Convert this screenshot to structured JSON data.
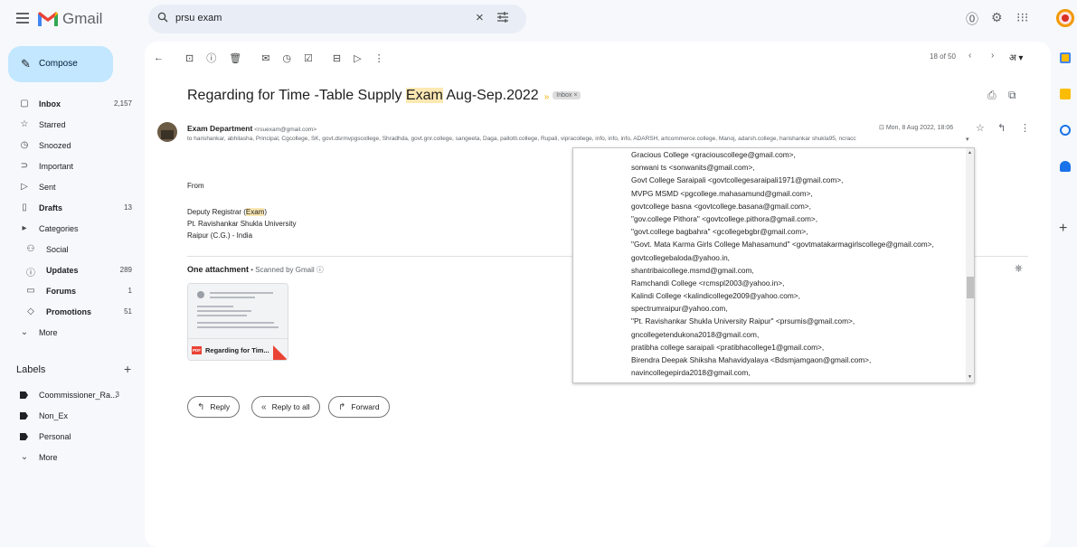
{
  "app": {
    "name": "Gmail"
  },
  "search": {
    "query": "prsu exam"
  },
  "compose": {
    "label": "Compose"
  },
  "nav": [
    {
      "label": "Inbox",
      "count": "2,157",
      "icon": "inbox-icon",
      "glyph": "▢",
      "bold": true
    },
    {
      "label": "Starred",
      "count": "",
      "icon": "star-icon",
      "glyph": "☆",
      "bold": false
    },
    {
      "label": "Snoozed",
      "count": "",
      "icon": "clock-icon",
      "glyph": "◷",
      "bold": false
    },
    {
      "label": "Important",
      "count": "",
      "icon": "important-icon",
      "glyph": "⊃",
      "bold": false
    },
    {
      "label": "Sent",
      "count": "",
      "icon": "send-icon",
      "glyph": "▷",
      "bold": false
    },
    {
      "label": "Drafts",
      "count": "13",
      "icon": "draft-icon",
      "glyph": "▯",
      "bold": true
    },
    {
      "label": "Categories",
      "count": "",
      "icon": "label-icon",
      "glyph": "▸",
      "bold": false
    },
    {
      "label": "Social",
      "count": "",
      "icon": "people-icon",
      "glyph": "⚇",
      "bold": false,
      "sub": true
    },
    {
      "label": "Updates",
      "count": "289",
      "icon": "info-icon",
      "glyph": "ⓘ",
      "bold": true,
      "sub": true
    },
    {
      "label": "Forums",
      "count": "1",
      "icon": "forum-icon",
      "glyph": "▭",
      "bold": true,
      "sub": true
    },
    {
      "label": "Promotions",
      "count": "51",
      "icon": "tag-icon",
      "glyph": "◇",
      "bold": true,
      "sub": true
    },
    {
      "label": "More",
      "count": "",
      "icon": "chevron-down-icon",
      "glyph": "⌄",
      "bold": false
    }
  ],
  "labels": {
    "header": "Labels",
    "items": [
      {
        "label": "Coommissioner_Ra...",
        "count": "3"
      },
      {
        "label": "Non_Ex",
        "count": ""
      },
      {
        "label": "Personal",
        "count": ""
      },
      {
        "label": "More",
        "count": ""
      }
    ]
  },
  "toolbar": {
    "pager": "18 of 50",
    "lang": "अ"
  },
  "email": {
    "subject_pre": "Regarding for Time -Table Supply ",
    "subject_hl": "Exam",
    "subject_post": " Aug-Sep.2022",
    "inbox_chip": "Inbox ×",
    "sender_name": "Exam Department",
    "sender_email": "<rsuexam@gmail.com>",
    "date": "Mon, 8 Aug 2022, 18:06",
    "recipients": "to harishankar, abhilasha, Principal, Cgcollege, SK, govt.dsrmvpgscollege, Shradhda, govt.gnr.college, sangeeta, Daga, pallotti.college, Rupali, vipracollege, info, info, info, ADARSH, artcommerce.college, Manoj, adarsh.college, harishankar shukla95, ncracc",
    "from_label": "From",
    "sig_pre": "Deputy Registrar (",
    "sig_hl": "Exam",
    "sig_post": ")",
    "sig_line2": "Pt. Ravishankar Shukla University",
    "sig_line3": "Raipur (C.G.) - India"
  },
  "attachment": {
    "header": "One attachment",
    "scan": " • Scanned by Gmail ⓘ",
    "name": "Regarding for Tim...",
    "badge": "PDF"
  },
  "buttons": {
    "reply": "Reply",
    "reply_all": "Reply to all",
    "forward": "Forward"
  },
  "popup": {
    "items": [
      "Gracious College <graciouscollege@gmail.com>,",
      "sonwani ts <sonwanits@gmail.com>,",
      "Govt College Saraipali <govtcollegesaraipali1971@gmail.com>,",
      "MVPG MSMD <pgcollege.mahasamund@gmail.com>,",
      "govtcollege basna <govtcollege.basana@gmail.com>,",
      "\"gov.college Pithora\" <govtcollege.pithora@gmail.com>,",
      "\"govt.college bagbahra\" <gcollegebgbr@gmail.com>,",
      "\"Govt. Mata Karma Girls College Mahasamund\" <govtmatakarmagirlscollege@gmail.com>,",
      "govtcollegebaloda@yahoo.in,",
      "shantribaicollege.msmd@gmail.com,",
      "Ramchandi College <rcmspl2003@yahoo.in>,",
      "Kalindi College <kalindicollege2009@yahoo.com>,",
      "spectrumraipur@yahoo.com,",
      "\"Pt. Ravishankar Shukla University Raipur\" <prsumis@gmail.com>,",
      "gncollegetendukona2018@gmail.com,",
      "pratibha college saraipali <pratibhacollege1@gmail.com>,",
      "Birendra Deepak Shiksha Mahavidyalaya <Bdsmjamgaon@gmail.com>,",
      "navincollegepirda2018@gmail.com,"
    ]
  }
}
